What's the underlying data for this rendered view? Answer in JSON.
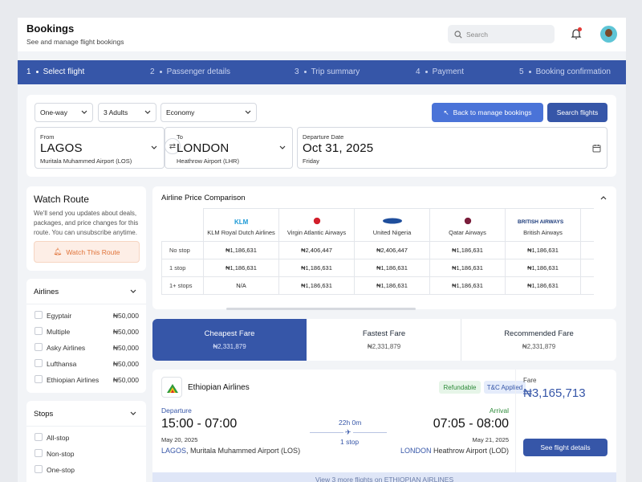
{
  "header": {
    "title": "Bookings",
    "subtitle": "See and manage flight bookings",
    "search_placeholder": "Search"
  },
  "colors": {
    "primary": "#3656a8",
    "accent": "#4a73d8",
    "warning": "#e0743a",
    "success": "#2e8b3a"
  },
  "steps": [
    {
      "num": "1",
      "label": "Select flight",
      "active": true
    },
    {
      "num": "2",
      "label": "Passenger details"
    },
    {
      "num": "3",
      "label": "Trip summary"
    },
    {
      "num": "4",
      "label": "Payment"
    },
    {
      "num": "5",
      "label": "Booking confirmation"
    }
  ],
  "search": {
    "trip_type": "One-way",
    "passengers": "3 Adults",
    "cabin": "Economy",
    "back_button": "Back to manage bookings",
    "search_button": "Search flights",
    "from": {
      "label": "From",
      "city": "LAGOS",
      "airport": "Muritala Muhammed Airport (LOS)"
    },
    "to": {
      "label": "To",
      "city": "LONDON",
      "airport": "Heathrow Airport (LHR)"
    },
    "departure": {
      "label": "Departure Date",
      "date": "Oct 31, 2025",
      "day": "Friday"
    }
  },
  "watch_route": {
    "title": "Watch Route",
    "description": "We'll send you updates about deals, packages, and price changes for this route. You can unsubscribe anytime.",
    "button": "Watch This Route"
  },
  "airlines_filter": {
    "title": "Airlines",
    "items": [
      {
        "name": "Egyptair",
        "price": "₦50,000"
      },
      {
        "name": "Multiple",
        "price": "₦50,000"
      },
      {
        "name": "Asky Airlines",
        "price": "₦50,000"
      },
      {
        "name": "Lufthansa",
        "price": "₦50,000"
      },
      {
        "name": "Ethiopian Airlines",
        "price": "₦50,000"
      }
    ]
  },
  "stops_filter": {
    "title": "Stops",
    "items": [
      "All-stop",
      "Non-stop",
      "One-stop"
    ]
  },
  "comparison": {
    "title": "Airline Price Comparison",
    "airlines": [
      "KLM Royal Dutch Airlines",
      "Virgin Atlantic Airways",
      "United Nigeria",
      "Qatar Airways",
      "British Airways"
    ],
    "rows": [
      {
        "label": "No stop",
        "values": [
          "₦1,186,631",
          "₦2,406,447",
          "₦2,406,447",
          "₦1,186,631",
          "₦1,186,631"
        ]
      },
      {
        "label": "1 stop",
        "values": [
          "₦1,186,631",
          "₦1,186,631",
          "₦1,186,631",
          "₦1,186,631",
          "₦1,186,631"
        ]
      },
      {
        "label": "1+ stops",
        "values": [
          "N/A",
          "₦1,186,631",
          "₦1,186,631",
          "₦1,186,631",
          "₦1,186,631"
        ]
      }
    ]
  },
  "fares": [
    {
      "name": "Cheapest Fare",
      "value": "₦2,331,879"
    },
    {
      "name": "Fastest Fare",
      "value": "₦2,331,879"
    },
    {
      "name": "Recommended Fare",
      "value": "₦2,331,879"
    }
  ],
  "flight": {
    "airline": "Ethiopian Airlines",
    "tag_refundable": "Refundable",
    "tag_tc": "T&C Applied",
    "departure_label": "Departure",
    "departure_time": "15:00 - 07:00",
    "departure_date": "May 20, 2025",
    "departure_city": "LAGOS",
    "departure_airport": ", Muritala Muhammed Airport (LOS)",
    "duration": "22h 0m",
    "stops": "1 stop",
    "arrival_label": "Arrival",
    "arrival_time": "07:05 - 08:00",
    "arrival_date": "May 21, 2025",
    "arrival_city": "LONDON",
    "arrival_airport": " Heathrow Airport (LOD)",
    "fare_label": "Fare",
    "fare_value": "₦3,165,713",
    "details_button": "See flight details"
  },
  "more_flights": "View 3 more flights on ETHIOPIAN AIRLINES"
}
